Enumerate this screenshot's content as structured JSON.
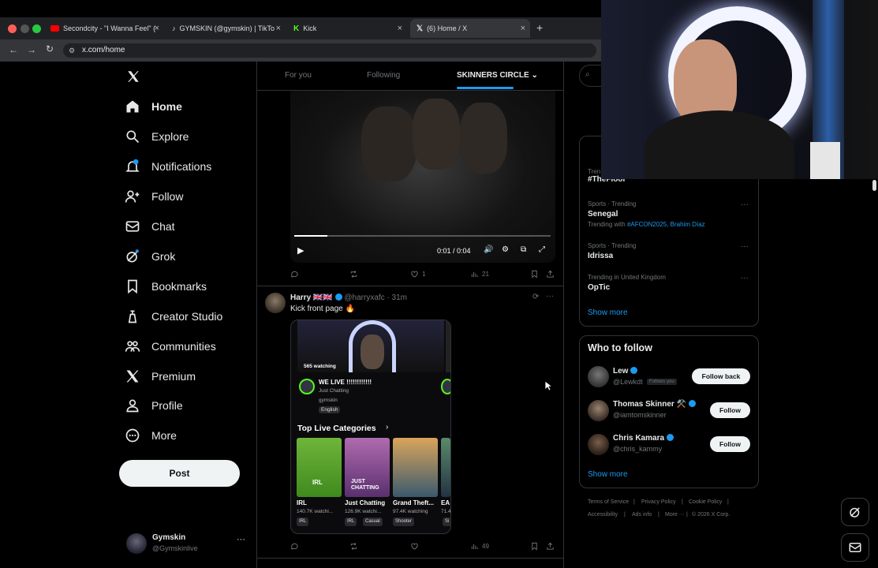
{
  "browser": {
    "tabs": [
      {
        "title": "Secondcity - \"I Wanna Feel\" (",
        "icon": "youtube-icon"
      },
      {
        "title": "GYMSKIN (@gymskin) | TikTo",
        "icon": "tiktok-icon"
      },
      {
        "title": "Kick",
        "icon": "kick-icon"
      },
      {
        "title": "(6) Home / X",
        "icon": "x-icon"
      }
    ],
    "url": "x.com/home"
  },
  "nav": {
    "items": [
      {
        "label": "Home",
        "icon": "home-icon"
      },
      {
        "label": "Explore",
        "icon": "search-icon"
      },
      {
        "label": "Notifications",
        "icon": "bell-icon"
      },
      {
        "label": "Follow",
        "icon": "add-user-icon"
      },
      {
        "label": "Chat",
        "icon": "mail-icon"
      },
      {
        "label": "Grok",
        "icon": "grok-icon"
      },
      {
        "label": "Bookmarks",
        "icon": "bookmark-icon"
      },
      {
        "label": "Creator Studio",
        "icon": "creator-icon"
      },
      {
        "label": "Communities",
        "icon": "communities-icon"
      },
      {
        "label": "Premium",
        "icon": "x-icon"
      },
      {
        "label": "Profile",
        "icon": "person-icon"
      },
      {
        "label": "More",
        "icon": "more-circle-icon"
      }
    ],
    "post_label": "Post",
    "account": {
      "name": "Gymskin",
      "handle": "@Gymskinlive"
    }
  },
  "feed": {
    "tabs": [
      "For you",
      "Following",
      "SKINNERS CIRCLE"
    ],
    "video": {
      "time": "0:01 / 0:04",
      "progress": 0.13
    },
    "post1_actions": {
      "likes": "1",
      "views": "21"
    },
    "post2": {
      "name": "Harry",
      "flags": "🇬🇧🇬🇧",
      "handle": "@harryxafc",
      "time": "· 31m",
      "text": "Kick front page 🔥",
      "views": "49"
    },
    "kick_card": {
      "watching": "565 watching",
      "stream_title": "WE LIVE !!!!!!!!!!!!",
      "category": "Just Chatting",
      "channel": "gymskin",
      "lang": "English",
      "section": "Top Live Categories",
      "categories": [
        {
          "name": "IRL",
          "watching": "140.7K watchi...",
          "tags": [
            "IRL"
          ]
        },
        {
          "name": "Just Chatting",
          "watching": "126.9K watchi...",
          "tags": [
            "IRL",
            "Casual"
          ]
        },
        {
          "name": "Grand Theft...",
          "watching": "97.4K watching",
          "tags": [
            "Shooter"
          ]
        },
        {
          "name": "EA",
          "watching": "71.4",
          "tags": [
            "Si"
          ]
        }
      ]
    }
  },
  "right": {
    "trends": [
      {
        "meta": "Tren",
        "name": "#TheFloor",
        "sub": ""
      },
      {
        "meta": "Sports · Trending",
        "name": "Senegal",
        "sub": "Trending with ",
        "links": "#AFCON2025, Brahim Díaz"
      },
      {
        "meta": "Sports · Trending",
        "name": "Idrissa",
        "sub": ""
      },
      {
        "meta": "Trending in United Kingdom",
        "name": "OpTic",
        "sub": ""
      }
    ],
    "show_more": "Show more",
    "wtf_title": "Who to follow",
    "follows": [
      {
        "name": "Lew",
        "handle": "@Lewkdt",
        "badge": "Follows you",
        "button": "Follow back"
      },
      {
        "name": "Thomas Skinner ⚒️",
        "handle": "@iamtomskinner",
        "badge": "",
        "button": "Follow"
      },
      {
        "name": "Chris Kamara",
        "handle": "@chris_kammy",
        "badge": "",
        "button": "Follow"
      }
    ],
    "footer": [
      "Terms of Service",
      "Privacy Policy",
      "Cookie Policy",
      "Accessibility",
      "Ads info",
      "More ···",
      "© 2026 X Corp."
    ]
  },
  "colors": {
    "accent": "#1d9bf0",
    "kick": "#53fc18",
    "bg": "#000000",
    "border": "#2f3336"
  }
}
